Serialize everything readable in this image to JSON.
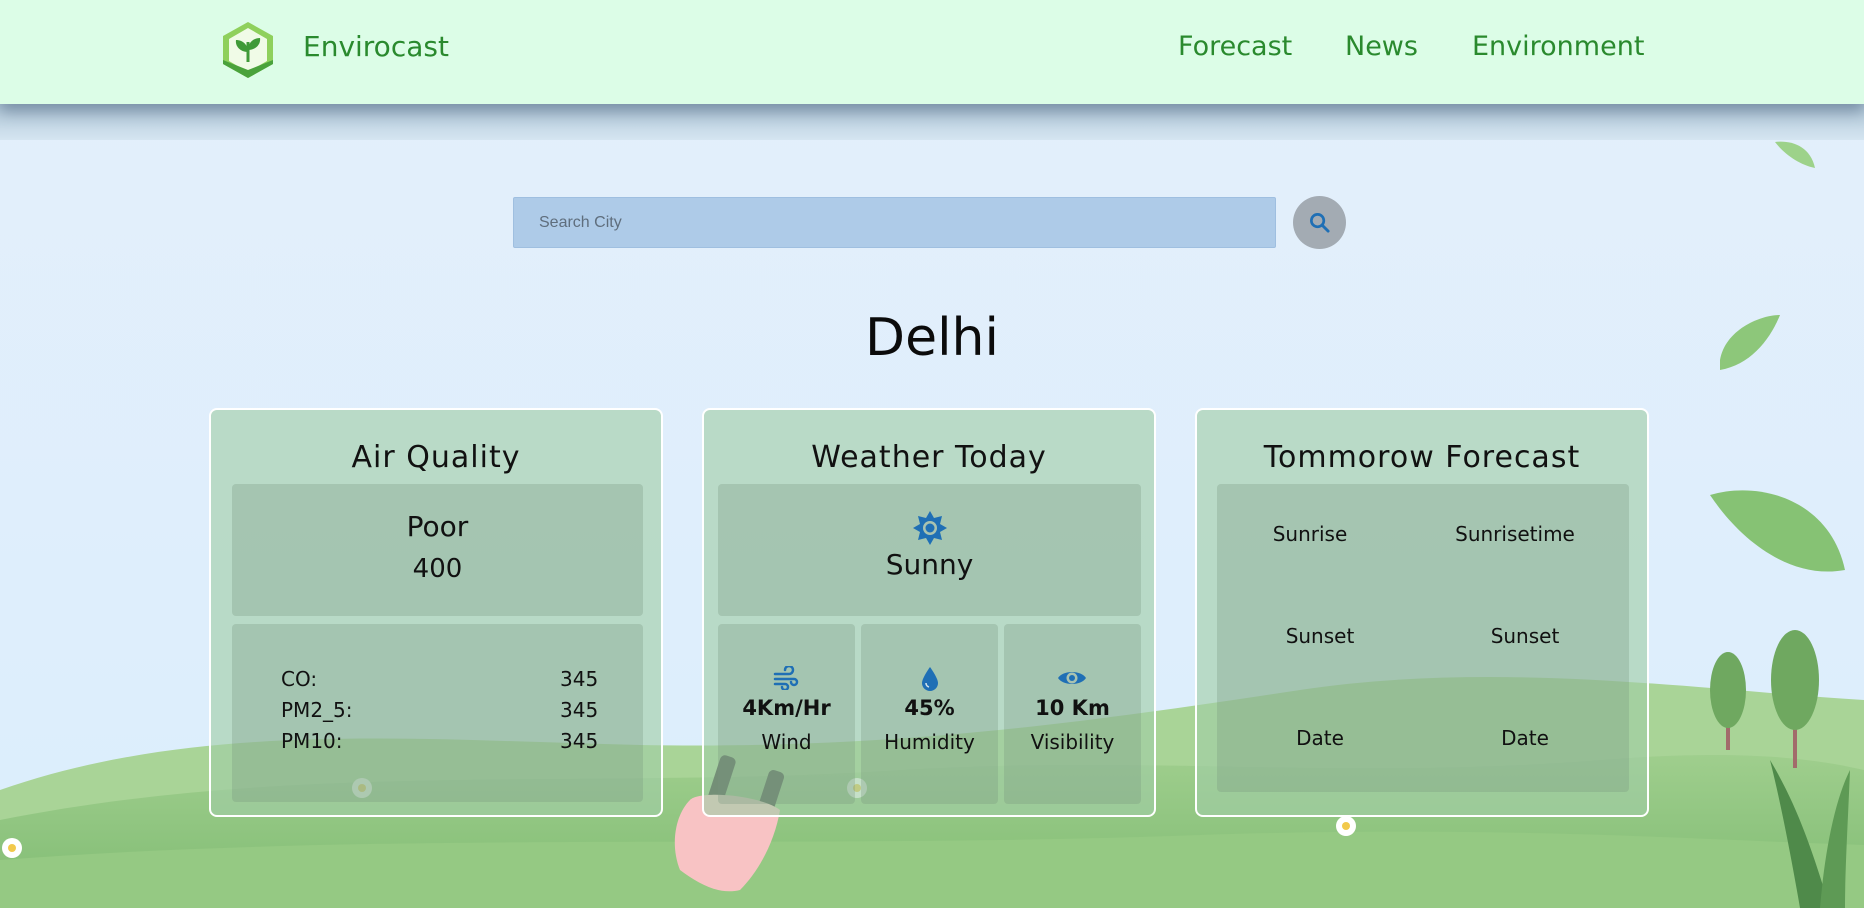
{
  "brand": {
    "name": "Envirocast",
    "logo_icon": "leaf-hexagon-icon"
  },
  "nav": {
    "links": [
      "Forecast",
      "News",
      "Environment"
    ]
  },
  "search": {
    "placeholder": "Search City",
    "value": "",
    "button_icon": "search-icon"
  },
  "city": "Delhi",
  "air_quality": {
    "title": "Air Quality",
    "status": "Poor",
    "aqi": "400",
    "pollutants": [
      {
        "label": "CO:",
        "value": "345"
      },
      {
        "label": "PM2_5:",
        "value": "345"
      },
      {
        "label": "PM10:",
        "value": "345"
      }
    ]
  },
  "weather": {
    "title": "Weather Today",
    "condition_icon": "sun-icon",
    "condition": "Sunny",
    "stats": [
      {
        "icon": "wind-icon",
        "value": "4Km/Hr",
        "label": "Wind"
      },
      {
        "icon": "droplet-icon",
        "value": "45%",
        "label": "Humidity"
      },
      {
        "icon": "eye-icon",
        "value": "10 Km",
        "label": "Visibility"
      }
    ]
  },
  "forecast": {
    "title": "Tommorow Forecast",
    "rows": [
      {
        "left": "Sunrise",
        "right": "Sunrisetime"
      },
      {
        "left": "Sunset",
        "right": "Sunset"
      },
      {
        "left": "Date",
        "right": "Date"
      }
    ]
  },
  "colors": {
    "nav_bg": "#dcfde7",
    "brand_green": "#2a8a2e",
    "card_bg": "#a2cda7",
    "icon_blue": "#1f6fb5",
    "sky": "#e6f1fb",
    "grass": "#8cc47c"
  }
}
